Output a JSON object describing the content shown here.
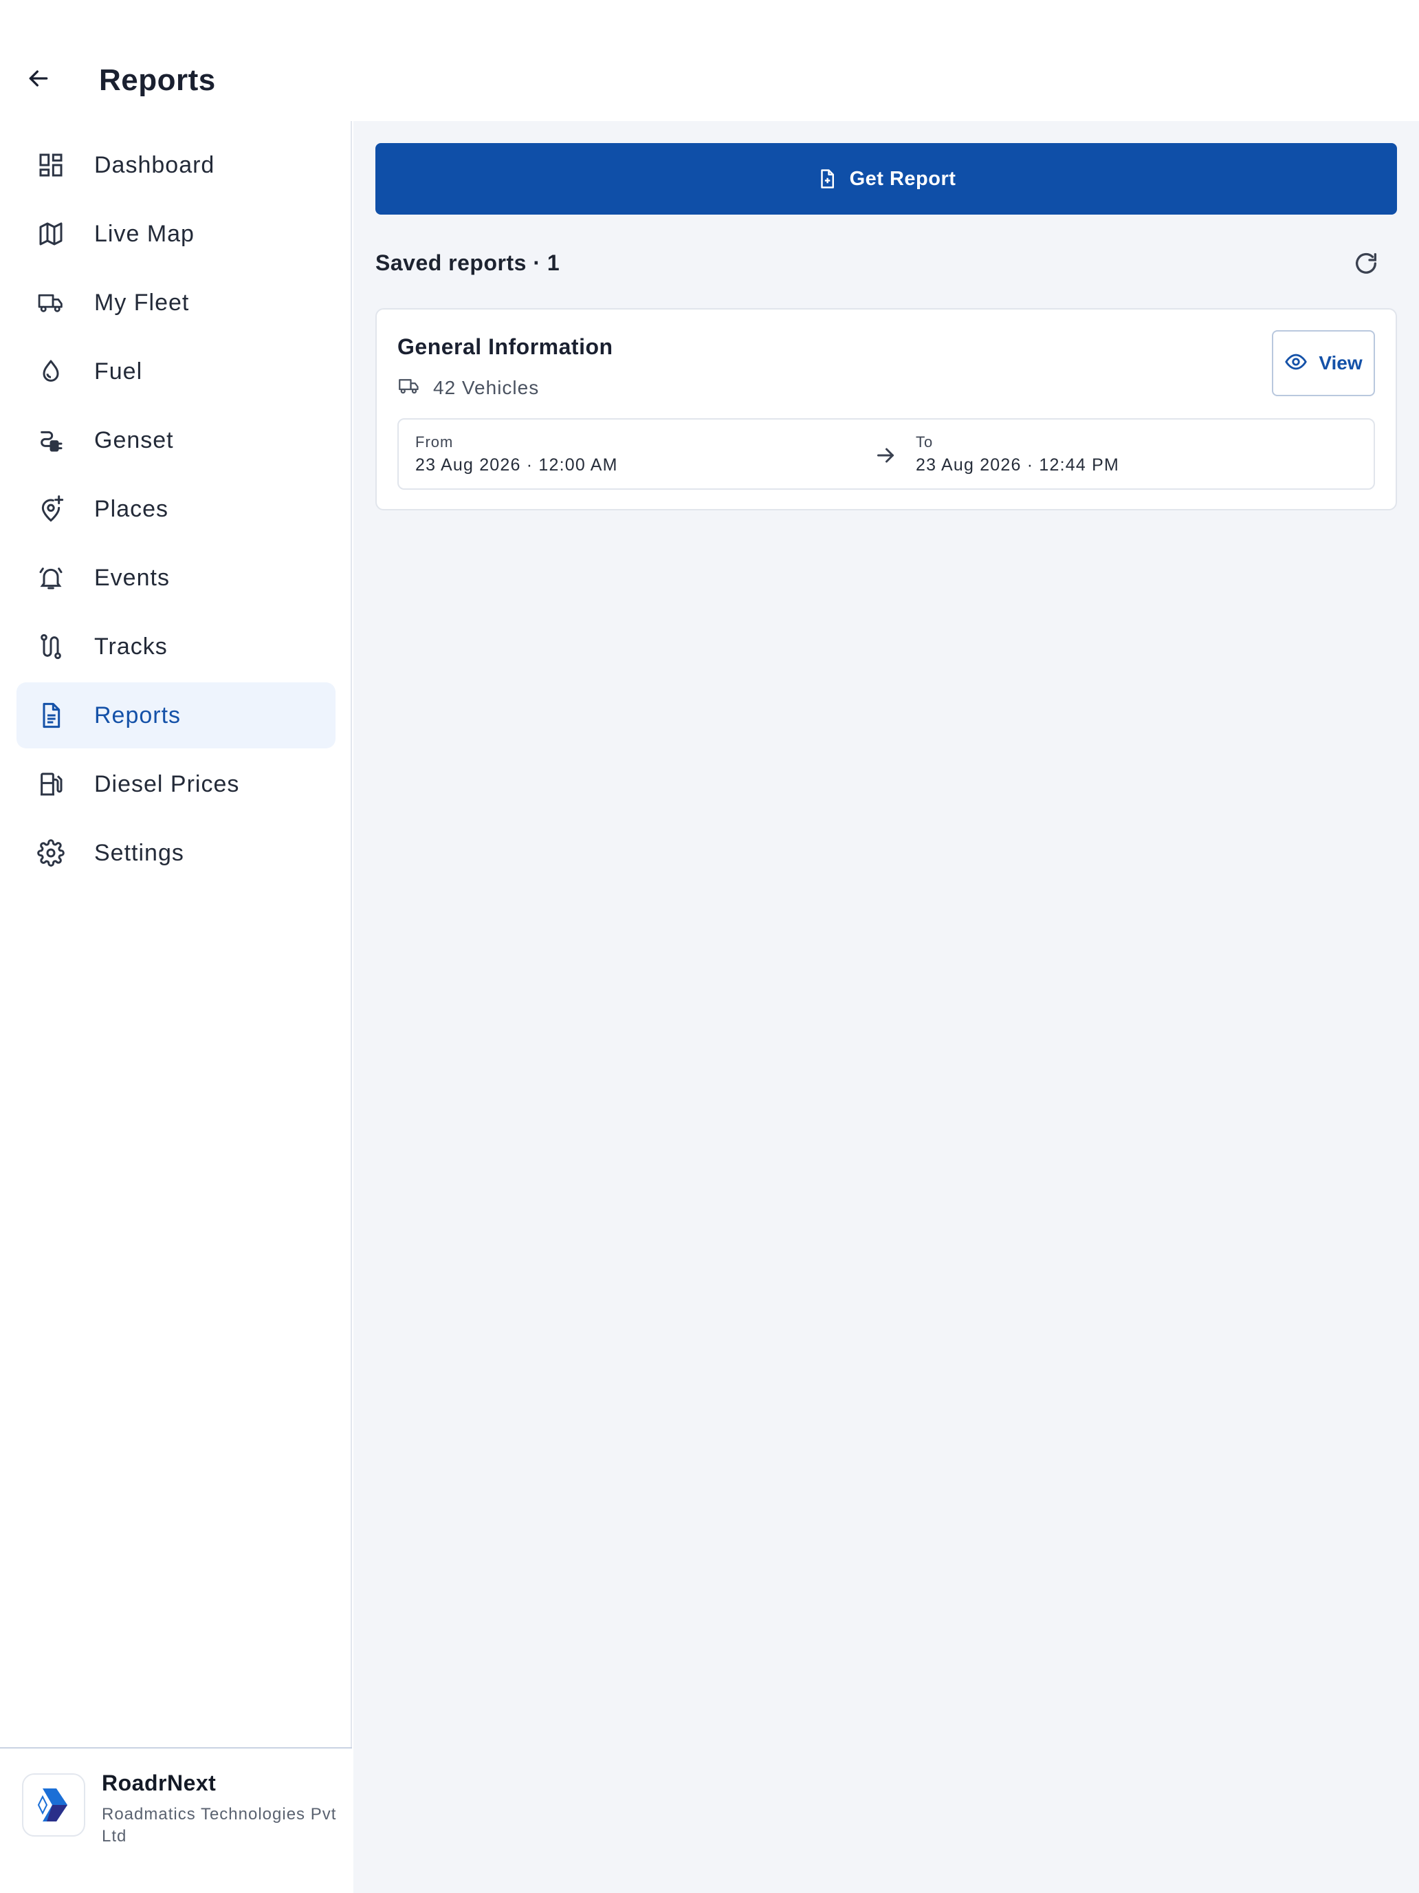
{
  "header": {
    "title": "Reports",
    "back_icon": "arrow-left-icon"
  },
  "sidebar": {
    "items": [
      {
        "label": "Dashboard",
        "icon": "dashboard-icon",
        "active": false
      },
      {
        "label": "Live Map",
        "icon": "map-icon",
        "active": false
      },
      {
        "label": "My Fleet",
        "icon": "truck-icon",
        "active": false
      },
      {
        "label": "Fuel",
        "icon": "fuel-drop-icon",
        "active": false
      },
      {
        "label": "Genset",
        "icon": "genset-plug-icon",
        "active": false
      },
      {
        "label": "Places",
        "icon": "place-pin-add-icon",
        "active": false
      },
      {
        "label": "Events",
        "icon": "alarm-bell-icon",
        "active": false
      },
      {
        "label": "Tracks",
        "icon": "route-icon",
        "active": false
      },
      {
        "label": "Reports",
        "icon": "document-icon",
        "active": true
      },
      {
        "label": "Diesel Prices",
        "icon": "fuel-pump-icon",
        "active": false
      },
      {
        "label": "Settings",
        "icon": "gear-icon",
        "active": false
      }
    ],
    "footer": {
      "brand": "RoadrNext",
      "company": "Roadmatics Technologies Pvt Ltd"
    }
  },
  "main": {
    "get_report_label": "Get Report",
    "saved_title": "Saved reports · 1",
    "report": {
      "title": "General Information",
      "vehicles": "42 Vehicles",
      "view_label": "View",
      "from_label": "From",
      "from_value": "23 Aug 2026 · 12:00 AM",
      "to_label": "To",
      "to_value": "23 Aug 2026 · 12:44 PM"
    }
  },
  "colors": {
    "primary": "#0f4fa8",
    "active_bg": "#eef4fd",
    "active_text": "#1451a8",
    "main_bg": "#f3f5f9"
  }
}
